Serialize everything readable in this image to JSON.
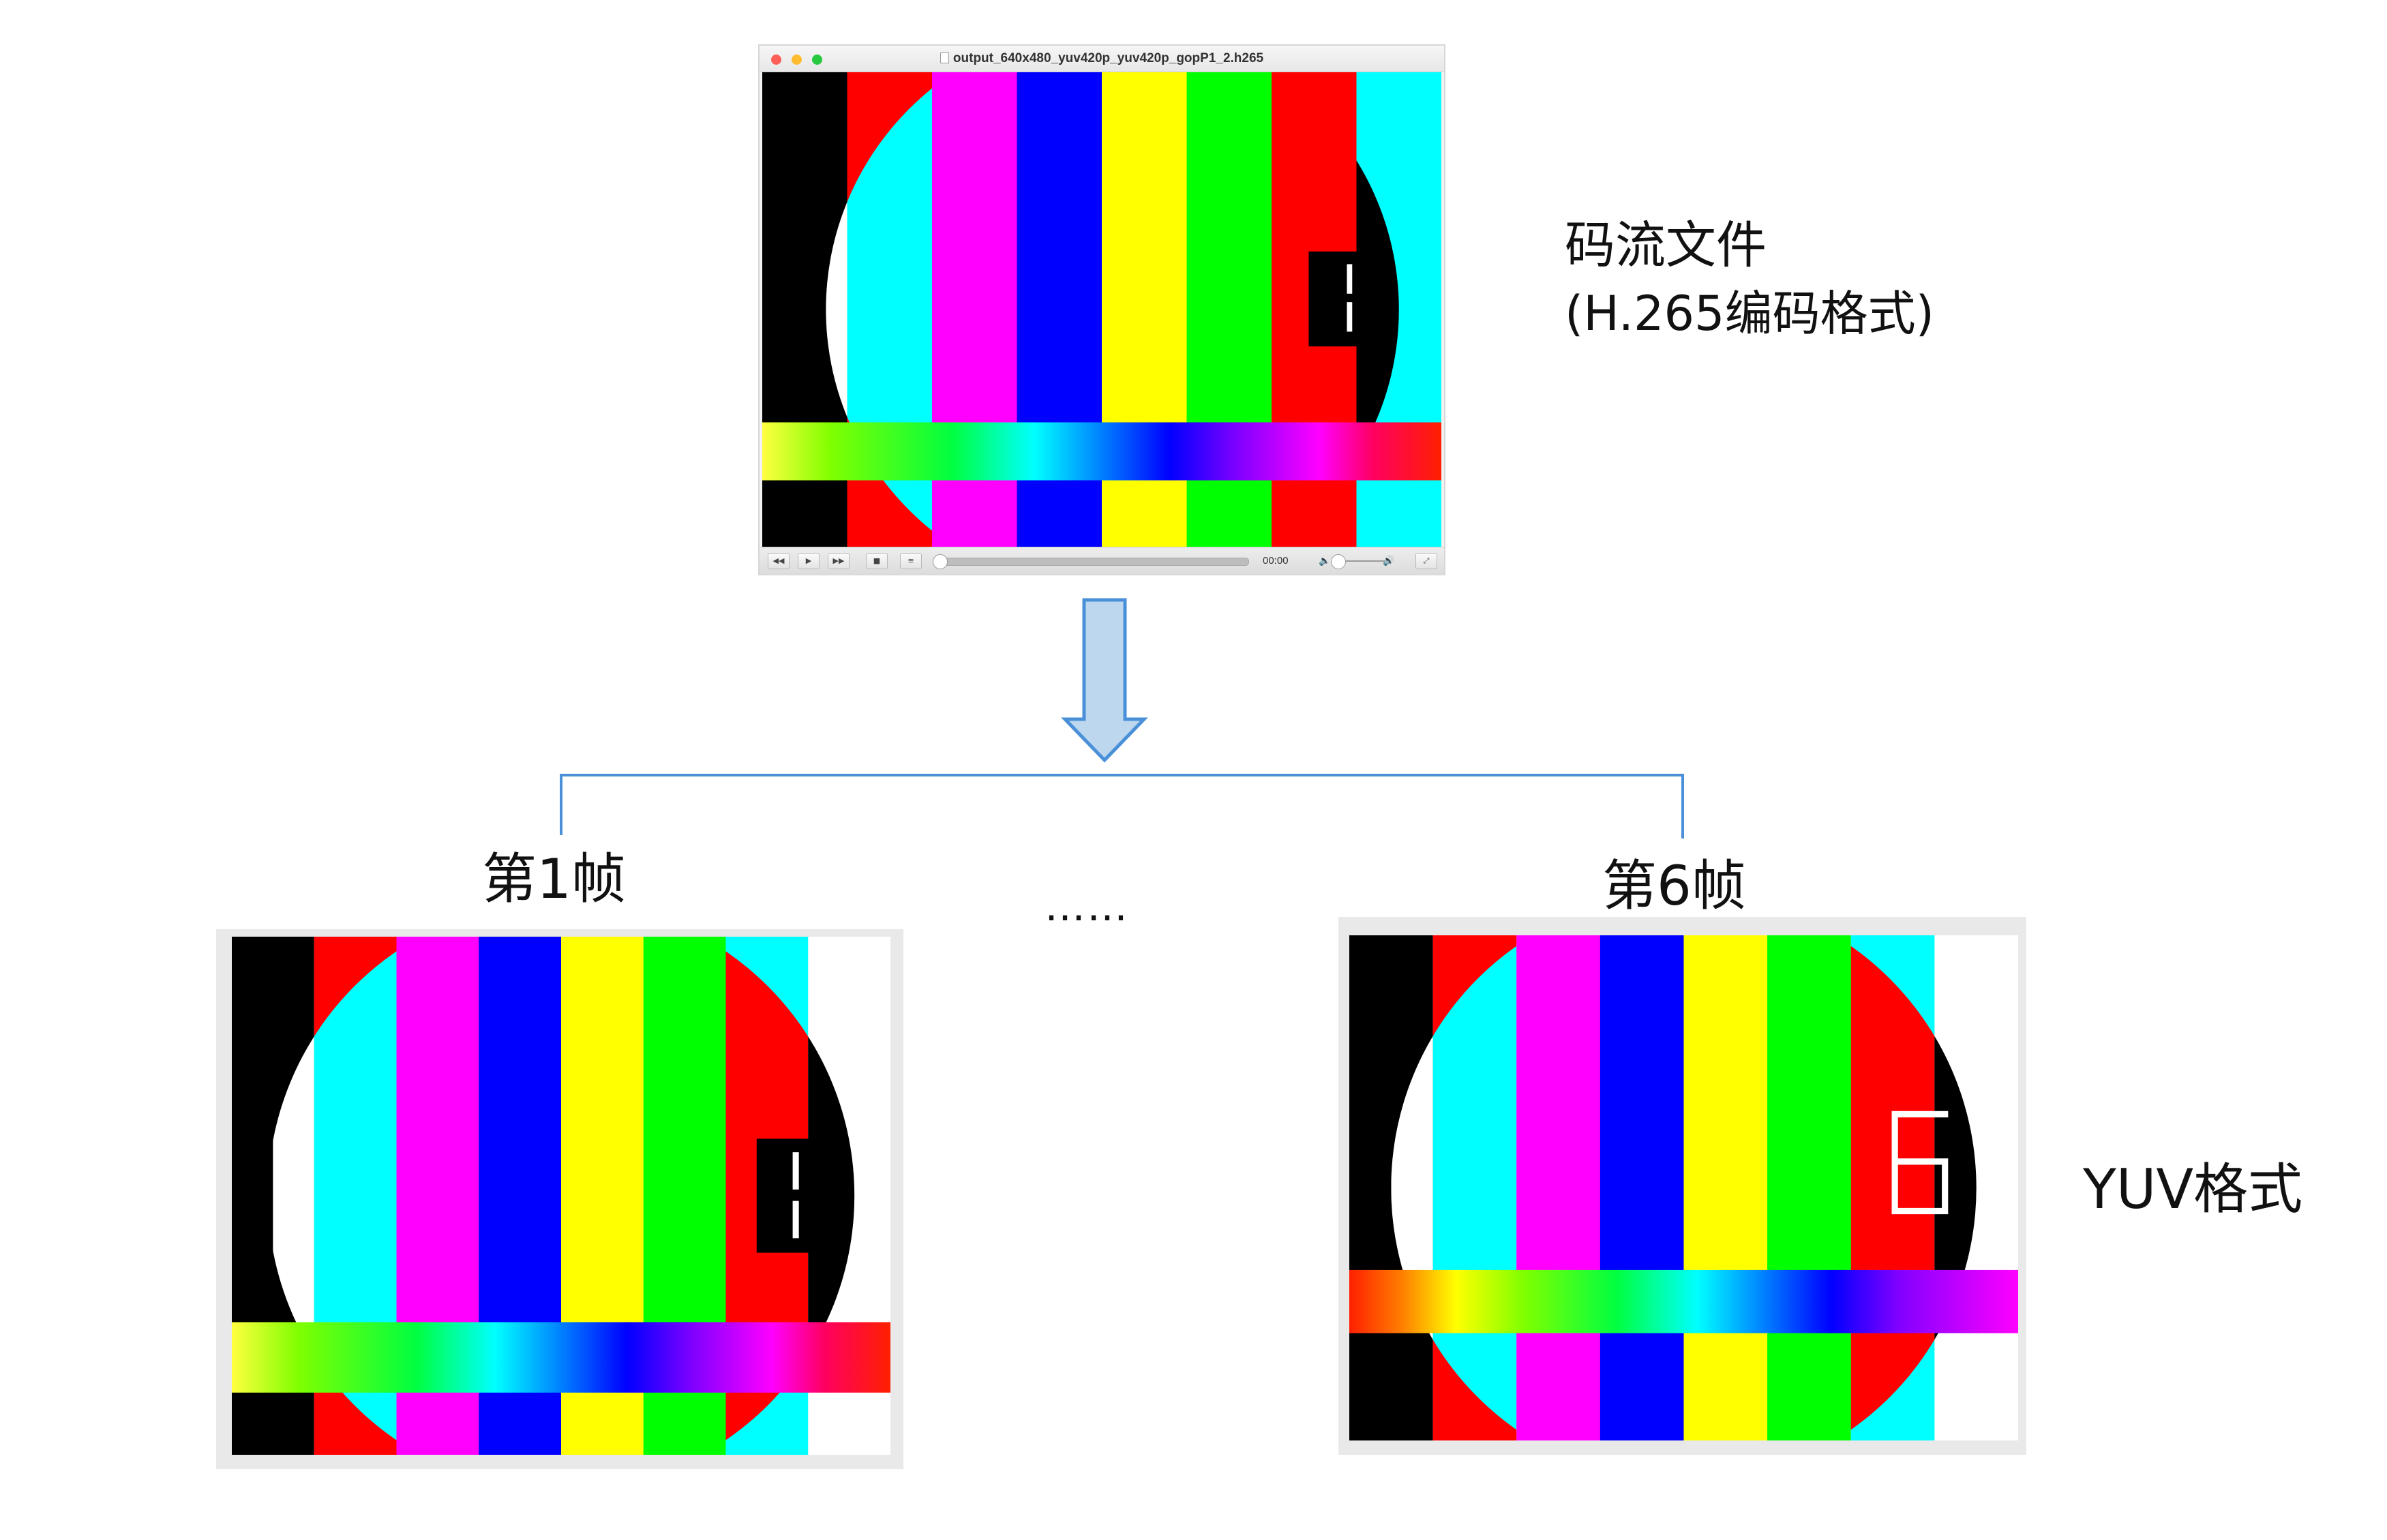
{
  "player": {
    "title": "output_640x480_yuv420p_yuv420p_gopP1_2.h265",
    "time": "00:00",
    "controls": {
      "rewind": "◀◀",
      "play": "▶",
      "forward": "▶▶",
      "stop": "■",
      "playlist": "≡",
      "fullscreen": "⤢"
    },
    "icons": {
      "vol_low": "🔈",
      "vol_high": "🔊"
    },
    "traffic_lights": {
      "close": "#ff5f57",
      "minimize": "#febc2e",
      "zoom": "#28c840"
    }
  },
  "labels": {
    "bitstream_title": "码流文件",
    "bitstream_subtitle": "(H.265编码格式)",
    "frame1": "第1帧",
    "frame6": "第6帧",
    "ellipsis": "……",
    "yuv": "YUV格式"
  },
  "frame_digits": {
    "first": "1",
    "sixth": "6"
  },
  "colors": {
    "arrow_fill": "#bdd7ee",
    "arrow_stroke": "#4a90d9",
    "bracket": "#4a90d9",
    "bars": [
      "#000000",
      "#ff0000",
      "#00ffff",
      "#ff00ff",
      "#0000ff",
      "#ffff00",
      "#00ff00",
      "#ff0000",
      "#00ffff",
      "#ffffff"
    ]
  }
}
